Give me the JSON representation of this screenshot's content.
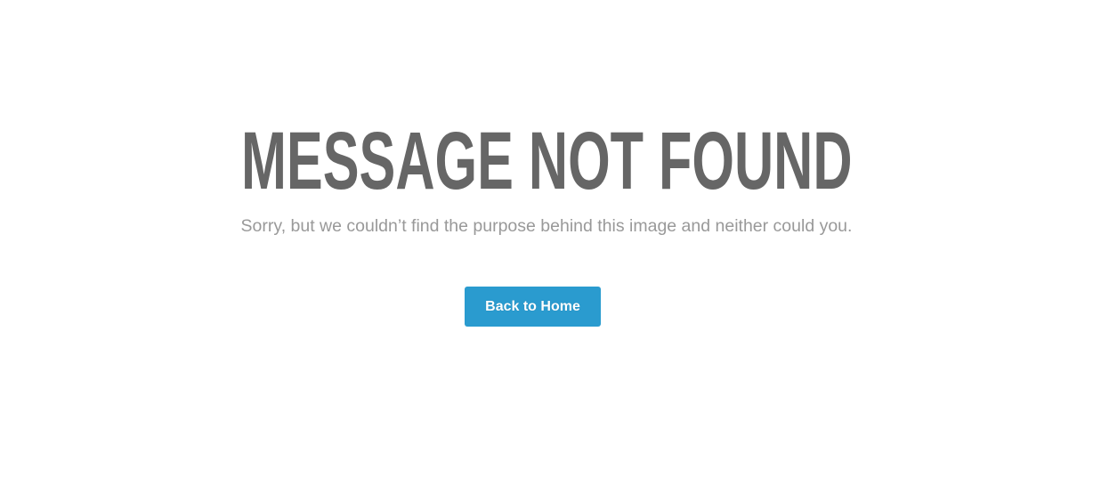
{
  "heading": "MESSAGE NOT FOUND",
  "subtitle": "Sorry, but we couldn’t find the purpose behind this image and neither could you.",
  "button": {
    "label": "Back to Home"
  },
  "colors": {
    "heading": "#666666",
    "subtitle": "#999999",
    "button_bg": "#2a9bcf",
    "button_text": "#ffffff"
  }
}
